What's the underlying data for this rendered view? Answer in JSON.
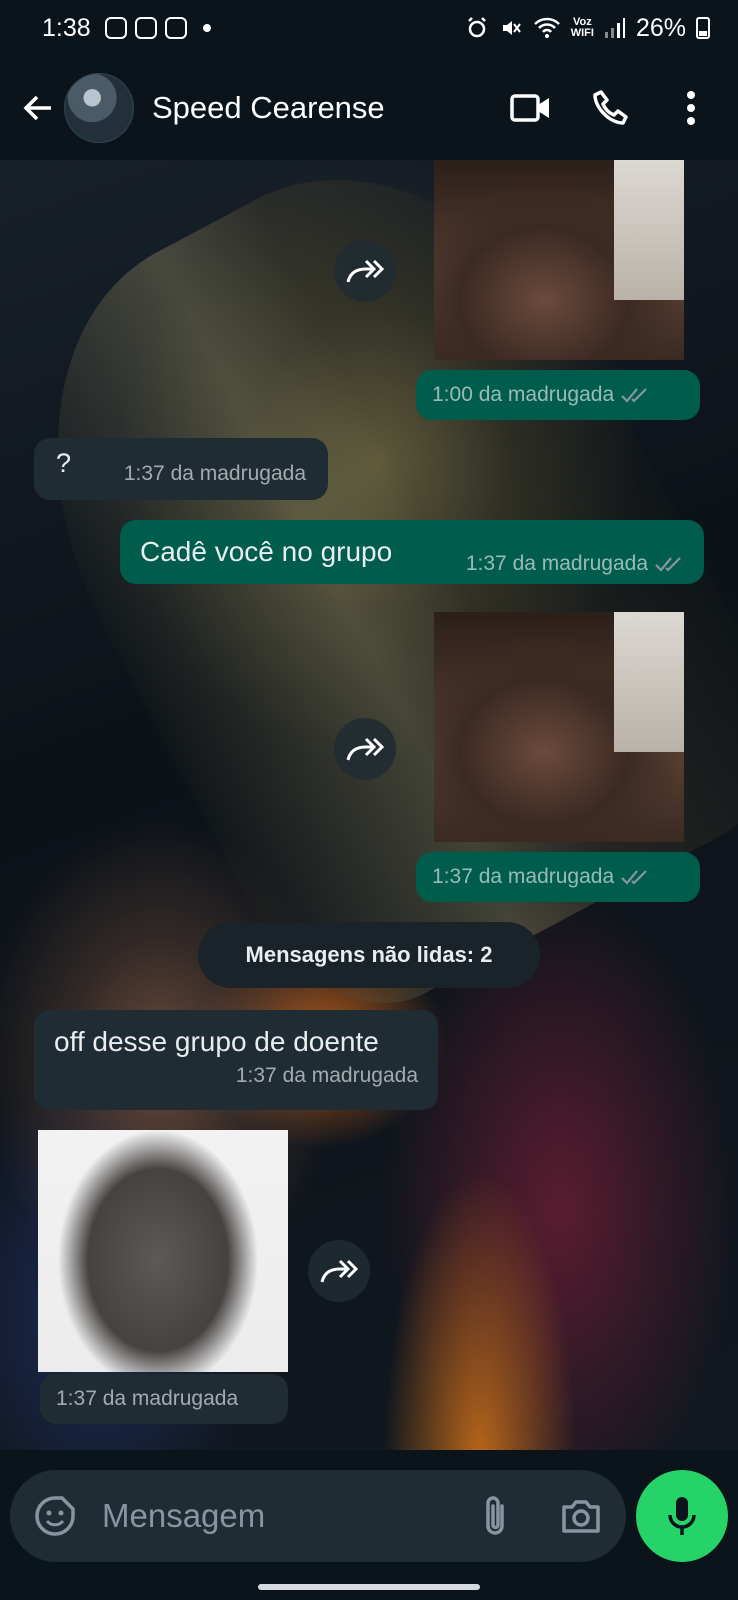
{
  "status_bar": {
    "time": "1:38",
    "voz_label_top": "Voz",
    "voz_label_bottom": "WIFI",
    "battery": "26%"
  },
  "header": {
    "contact_name": "Speed Cearense",
    "icons": [
      "back-arrow-icon",
      "video-call-icon",
      "phone-icon",
      "more-vert-icon"
    ]
  },
  "messages": [
    {
      "type": "image",
      "direction": "out",
      "time": "1:00 da madrugada",
      "status": "read"
    },
    {
      "type": "text",
      "direction": "in",
      "text": "?",
      "time": "1:37 da madrugada"
    },
    {
      "type": "text",
      "direction": "out",
      "text": "Cadê você no grupo",
      "time": "1:37 da madrugada",
      "status": "read"
    },
    {
      "type": "image",
      "direction": "out",
      "time": "1:37 da madrugada",
      "status": "read"
    },
    {
      "type": "divider",
      "text": "Mensagens não lidas: 2"
    },
    {
      "type": "text",
      "direction": "in",
      "text": "off desse grupo de doente",
      "time": "1:37 da madrugada"
    },
    {
      "type": "image",
      "direction": "in",
      "time": "1:37 da madrugada"
    }
  ],
  "composer": {
    "placeholder": "Mensagem"
  },
  "colors": {
    "outgoing_bubble": "#005c4b",
    "incoming_bubble": "#202c33",
    "mic_button": "#25d366",
    "read_ticks": "#8696a0"
  }
}
